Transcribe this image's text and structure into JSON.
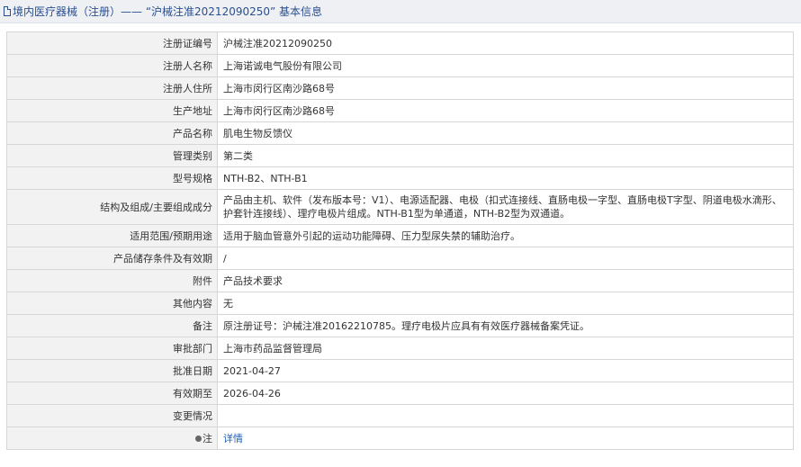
{
  "header": {
    "title": "境内医疗器械（注册）——  “沪械注准20212090250”  基本信息"
  },
  "rows": [
    {
      "label": "注册证编号",
      "value": "沪械注准20212090250"
    },
    {
      "label": "注册人名称",
      "value": "上海诺诚电气股份有限公司"
    },
    {
      "label": "注册人住所",
      "value": "上海市闵行区南沙路68号"
    },
    {
      "label": "生产地址",
      "value": "上海市闵行区南沙路68号"
    },
    {
      "label": "产品名称",
      "value": "肌电生物反馈仪"
    },
    {
      "label": "管理类别",
      "value": "第二类"
    },
    {
      "label": "型号规格",
      "value": "NTH-B2、NTH-B1"
    },
    {
      "label": "结构及组成/主要组成成分",
      "value": "产品由主机、软件（发布版本号：V1）、电源适配器、电极（扣式连接线、直肠电极一字型、直肠电极T字型、阴道电极水滴形、护套针连接线）、理疗电极片组成。NTH-B1型为单通道，NTH-B2型为双通道。"
    },
    {
      "label": "适用范围/预期用途",
      "value": "适用于脑血管意外引起的运动功能障碍、压力型尿失禁的辅助治疗。"
    },
    {
      "label": "产品储存条件及有效期",
      "value": "/"
    },
    {
      "label": "附件",
      "value": "产品技术要求"
    },
    {
      "label": "其他内容",
      "value": "无"
    },
    {
      "label": "备注",
      "value": "原注册证号：沪械注准20162210785。理疗电极片应具有有效医疗器械备案凭证。"
    },
    {
      "label": "审批部门",
      "value": "上海市药品监督管理局"
    },
    {
      "label": "批准日期",
      "value": "2021-04-27"
    },
    {
      "label": "有效期至",
      "value": "2026-04-26"
    },
    {
      "label": "变更情况",
      "value": ""
    }
  ],
  "note": {
    "label": "注",
    "link": "详情",
    "icon": "pin-icon"
  },
  "colors": {
    "title": "#2a4f8e",
    "link": "#1d5fb8",
    "label_bg": "#f2f2f2",
    "border": "#d6d6d6"
  }
}
